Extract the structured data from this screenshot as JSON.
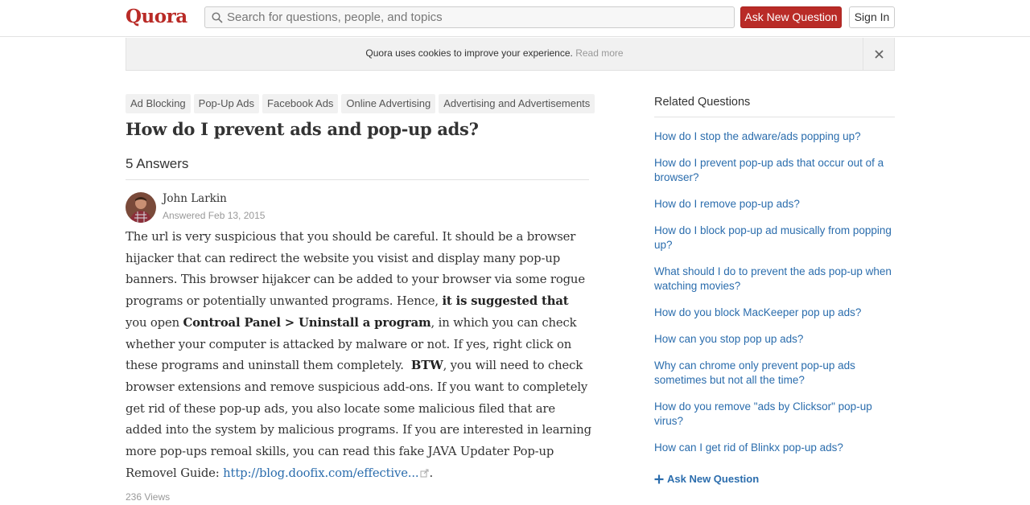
{
  "header": {
    "logo": "Quora",
    "search_placeholder": "Search for questions, people, and topics",
    "ask_label": "Ask New Question",
    "signin_label": "Sign In"
  },
  "cookie": {
    "text": "Quora uses cookies to improve your experience.",
    "link": "Read more"
  },
  "topics": [
    "Ad Blocking",
    "Pop-Up Ads",
    "Facebook Ads",
    "Online Advertising",
    "Advertising and Advertisements"
  ],
  "question": {
    "title": "How do I prevent ads and pop-up ads?",
    "answer_count": "5 Answers"
  },
  "answer": {
    "author": "John Larkin",
    "date": "Answered Feb 13, 2015",
    "p1": "The url is very suspicious that you should be careful. It should be a browser hijacker that can redirect the website you visist and display many pop-up banners. This browser hijakcer can be added to your browser via some rogue programs or potentially unwanted programs. Hence,",
    "b1": "it is suggested that",
    "p2": "you open",
    "b2": "Controal Panel > Uninstall a program",
    "p3": ", in which you can check whether your computer is attacked by malware or not. If yes, right click on these programs and uninstall them completely.",
    "b3": "BTW",
    "p4": ", you will need to check browser extensions and remove suspicious add-ons. If you want to completely get rid of these pop-up ads, you also locate some malicious filed that are added into the system by malicious programs. If you are interested in learning more pop-ups remoal skills, you can read this fake JAVA Updater Pop-up Removel Guide:",
    "link": "http://blog.doofix.com/effective...",
    "p5": ".",
    "views": "236 Views"
  },
  "sidebar": {
    "title": "Related Questions",
    "items": [
      "How do I stop the adware/ads popping up?",
      "How do I prevent pop-up ads that occur out of a browser?",
      "How do I remove pop-up ads?",
      "How do I block pop-up ad musically from popping up?",
      "What should I do to prevent the ads pop-up when watching movies?",
      "How do you block MacKeeper pop up ads?",
      "How can you stop pop up ads?",
      "Why can chrome only prevent pop-up ads sometimes but not all the time?",
      "How do you remove \"ads by Clicksor\" pop-up virus?",
      "How can I get rid of Blinkx pop-up ads?"
    ],
    "ask_label": "Ask New Question"
  },
  "icons": {
    "search": "search-icon",
    "close": "close-icon",
    "external": "external-link-icon",
    "plus": "plus-icon"
  },
  "colors": {
    "brand": "#b92b27",
    "link": "#2b6dad"
  }
}
